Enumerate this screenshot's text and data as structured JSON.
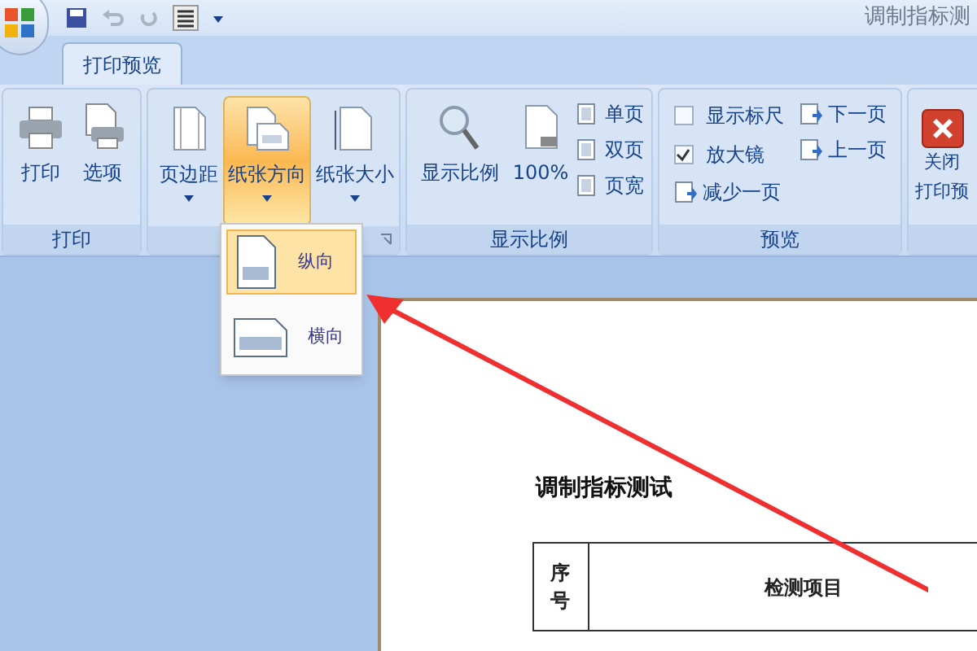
{
  "window": {
    "title": "调制指标测"
  },
  "tabs": [
    {
      "label": "打印预览",
      "selected": true
    }
  ],
  "ribbon": {
    "groups": [
      {
        "label": "打印",
        "columns": [
          [
            {
              "kind": "large",
              "label": "打印"
            }
          ],
          [
            {
              "kind": "large",
              "label": "选项"
            }
          ]
        ]
      },
      {
        "launcher": true,
        "columns": [
          [
            {
              "kind": "dropdown",
              "label": "页边距",
              "active": false
            }
          ],
          [
            {
              "kind": "dropdown",
              "label": "纸张方向",
              "active": true
            }
          ],
          [
            {
              "kind": "dropdown",
              "label": "纸张大小",
              "active": false
            }
          ]
        ]
      },
      {
        "label": "显示比例",
        "columns": [
          [
            {
              "kind": "large",
              "label": "显示比例"
            }
          ],
          [
            {
              "kind": "large",
              "label": "100%"
            }
          ],
          [
            {
              "kind": "small",
              "label": "单页"
            },
            {
              "kind": "small",
              "label": "双页"
            },
            {
              "kind": "small",
              "label": "页宽"
            }
          ]
        ]
      },
      {
        "label": "预览",
        "columns": [
          [
            {
              "kind": "checkbox",
              "label": "显示标尺",
              "checked": false
            },
            {
              "kind": "checkbox",
              "label": "放大镜",
              "checked": true
            },
            {
              "kind": "small",
              "label": "减少一页"
            }
          ],
          [
            {
              "kind": "small",
              "label": "下一页"
            },
            {
              "kind": "small",
              "label": "上一页"
            }
          ]
        ]
      },
      {
        "columns": [
          [
            {
              "kind": "close",
              "lines": [
                "关闭",
                "打印预"
              ]
            }
          ]
        ]
      }
    ]
  },
  "menu": {
    "items": [
      {
        "label": "纵向",
        "selected": true
      },
      {
        "label": "横向",
        "selected": false
      }
    ]
  },
  "document": {
    "title": "调制指标测试",
    "columns": [
      "序号",
      "检测项目"
    ]
  }
}
